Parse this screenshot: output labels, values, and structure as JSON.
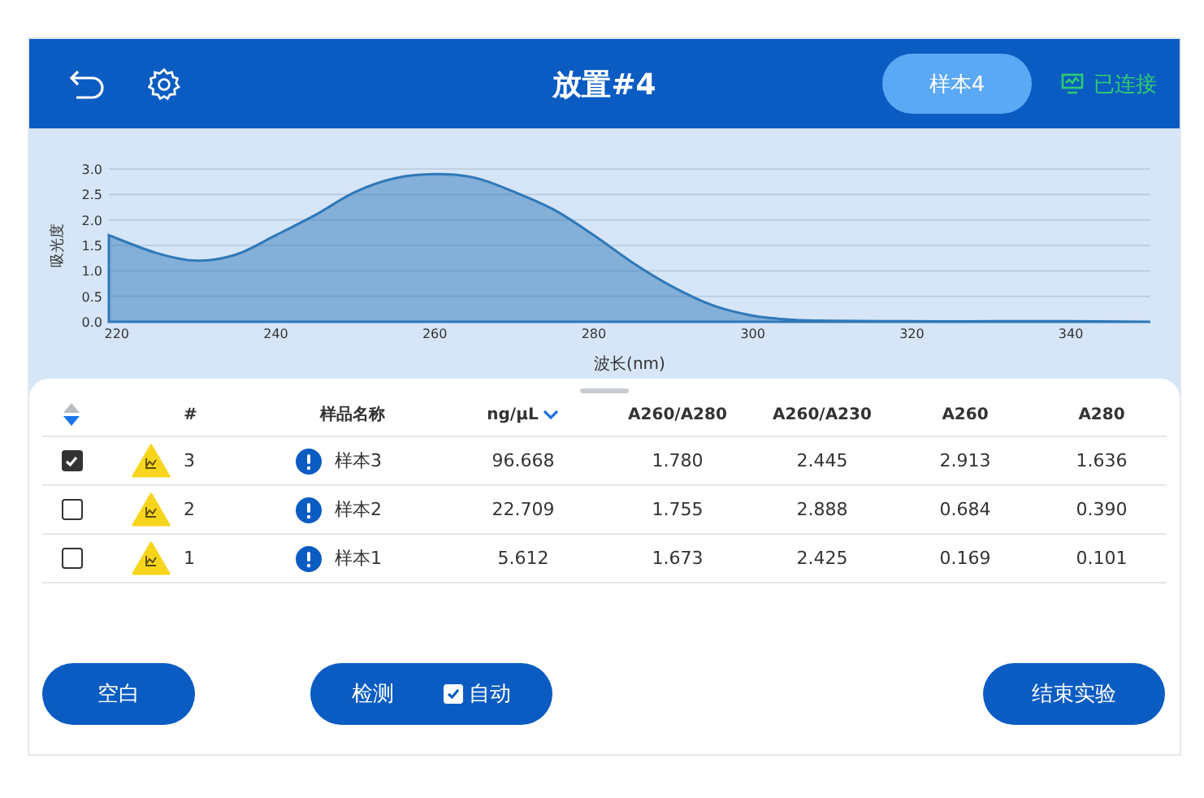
{
  "header": {
    "title": "放置#4",
    "sample_button": "样本4",
    "connection": {
      "label": "已连接",
      "connected": true
    }
  },
  "chart": {
    "chart_data": {
      "type": "area",
      "grid": true,
      "xlabel": "波长(nm)",
      "ylabel": "吸光度",
      "xlim": [
        219,
        350
      ],
      "ylim": [
        0,
        3
      ],
      "xticks": [
        220,
        240,
        260,
        280,
        300,
        320,
        340
      ],
      "yticks": [
        {
          "value": 0,
          "label": "0.0"
        },
        {
          "value": 0.5,
          "label": "0.5"
        },
        {
          "value": 1,
          "label": "1.0"
        },
        {
          "value": 1.5,
          "label": "1.5"
        },
        {
          "value": 2,
          "label": "2.0"
        },
        {
          "value": 2.5,
          "label": "2.5"
        },
        {
          "value": 3,
          "label": "3.0"
        }
      ],
      "x": [
        219,
        225,
        230,
        235,
        240,
        245,
        250,
        255,
        260,
        265,
        270,
        275,
        280,
        285,
        290,
        295,
        300,
        305,
        310,
        320,
        330,
        340,
        350
      ],
      "series": [
        {
          "color": "#2f78b8",
          "values": [
            1.7,
            1.35,
            1.2,
            1.32,
            1.7,
            2.1,
            2.55,
            2.82,
            2.9,
            2.83,
            2.55,
            2.2,
            1.7,
            1.15,
            0.68,
            0.32,
            0.12,
            0.04,
            0.02,
            0.01,
            0.01,
            0.01,
            0.0
          ]
        }
      ]
    }
  },
  "table": {
    "sort_descending": true,
    "columns": [
      {
        "label": "#",
        "sorted": false
      },
      {
        "label": "样品名称",
        "sorted": false
      },
      {
        "label": "ng/μL",
        "sorted": true
      },
      {
        "label": "A260/A280",
        "sorted": false
      },
      {
        "label": "A260/A230",
        "sorted": false
      },
      {
        "label": "A260",
        "sorted": false
      },
      {
        "label": "A280",
        "sorted": false
      }
    ],
    "rows": [
      {
        "checked": true,
        "number": "3",
        "name": "样本3",
        "values": [
          "96.668",
          "1.780",
          "2.445",
          "2.913",
          "1.636"
        ]
      },
      {
        "checked": false,
        "number": "2",
        "name": "样本2",
        "values": [
          "22.709",
          "1.755",
          "2.888",
          "0.684",
          "0.390"
        ]
      },
      {
        "checked": false,
        "number": "1",
        "name": "样本1",
        "values": [
          "5.612",
          "1.673",
          "2.425",
          "0.169",
          "0.101"
        ]
      }
    ]
  },
  "footer": {
    "blank_button": "空白",
    "detect_button": {
      "label": "检测",
      "auto": {
        "label": "自动",
        "checked": true
      }
    },
    "end_button": "结束实验"
  }
}
